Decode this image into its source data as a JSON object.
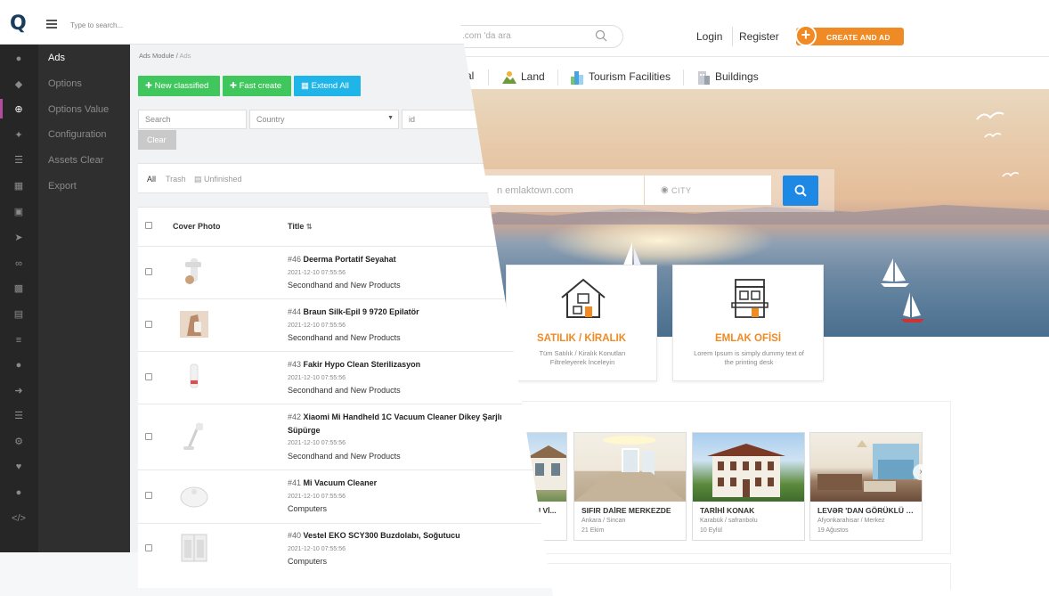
{
  "site": {
    "search_placeholder": ".com 'da ara",
    "login": "Login",
    "register": "Register",
    "create_ad": "CREATE AND AD",
    "categories": [
      "al",
      "Land",
      "Tourism Facilities",
      "Buildings"
    ],
    "hero": {
      "search_placeholder": "n emlaktown.com",
      "city_placeholder": "CITY"
    },
    "cards": [
      {
        "title": "SATILIK / KİRALIK",
        "desc": "Tüm Satılık / Kiralık Konutları Filtreleyerek İnceleyin",
        "icon": "house-icon"
      },
      {
        "title": "EMLAK OFİSİ",
        "desc": "Lorem Ipsum is simply dummy text of the printing desk",
        "icon": "office-building-icon"
      }
    ],
    "listings": [
      {
        "title": "U Vİ...",
        "location": "",
        "date": ""
      },
      {
        "title": "SIFIR DAİRE MERKEZDE",
        "location": "Ankara / Sincan",
        "date": "21 Ekim"
      },
      {
        "title": "TARİHİ KONAK",
        "location": "Karabük / safranbolu",
        "date": "10 Eylül"
      },
      {
        "title": "LEVƏR 'DAN GÖRÜKLÜ DE...",
        "location": "Afyonkarahisar / Merkez",
        "date": "19 Ağustos"
      }
    ]
  },
  "panel": {
    "logo": "Q",
    "search_placeholder": "Type to search...",
    "menu": [
      "Ads",
      "Options",
      "Options Value",
      "Configuration",
      "Assets Clear",
      "Export"
    ],
    "breadcrumb": {
      "module": "Ads Module",
      "sep": "/",
      "current": "Ads"
    },
    "buttons": {
      "new": "New classified",
      "fast": "Fast create",
      "extend": "Extend All"
    },
    "filters": {
      "search": "Search",
      "country": "Country",
      "id": "id",
      "clear": "Clear"
    },
    "tabs": {
      "all": "All",
      "trash": "Trash",
      "unfinished": "Unfinished"
    },
    "table": {
      "cover_header": "Cover Photo",
      "title_header": "Title",
      "rows": [
        {
          "id": "#46",
          "title": "Deerma Portatif Seyahat",
          "date": "2021-12-10 07:55:56",
          "category": "Secondhand and New Products"
        },
        {
          "id": "#44",
          "title": "Braun Silk-Epil 9 9720 Epilatör",
          "date": "2021-12-10 07:55:56",
          "category": "Secondhand and New Products"
        },
        {
          "id": "#43",
          "title": "Fakir Hypo Clean Sterilizasyon",
          "date": "2021-12-10 07:55:56",
          "category": "Secondhand and New Products"
        },
        {
          "id": "#42",
          "title": "Xiaomi Mi Handheld 1C Vacuum Cleaner Dikey Şarjlı Süpürge",
          "date": "2021-12-10 07:55:56",
          "category": "Secondhand and New Products"
        },
        {
          "id": "#41",
          "title": "Mi Vacuum Cleaner",
          "date": "2021-12-10 07:55:56",
          "category": "Computers"
        },
        {
          "id": "#40",
          "title": "Vestel EKO SCY300 Buzdolabı, Soğutucu",
          "date": "2021-12-10 07:55:56",
          "category": "Computers"
        }
      ]
    },
    "colors": {
      "green": "#3fc65c",
      "cyan": "#1fb5e8",
      "sidebar": "#262626",
      "accent": "#b14c9e"
    }
  }
}
